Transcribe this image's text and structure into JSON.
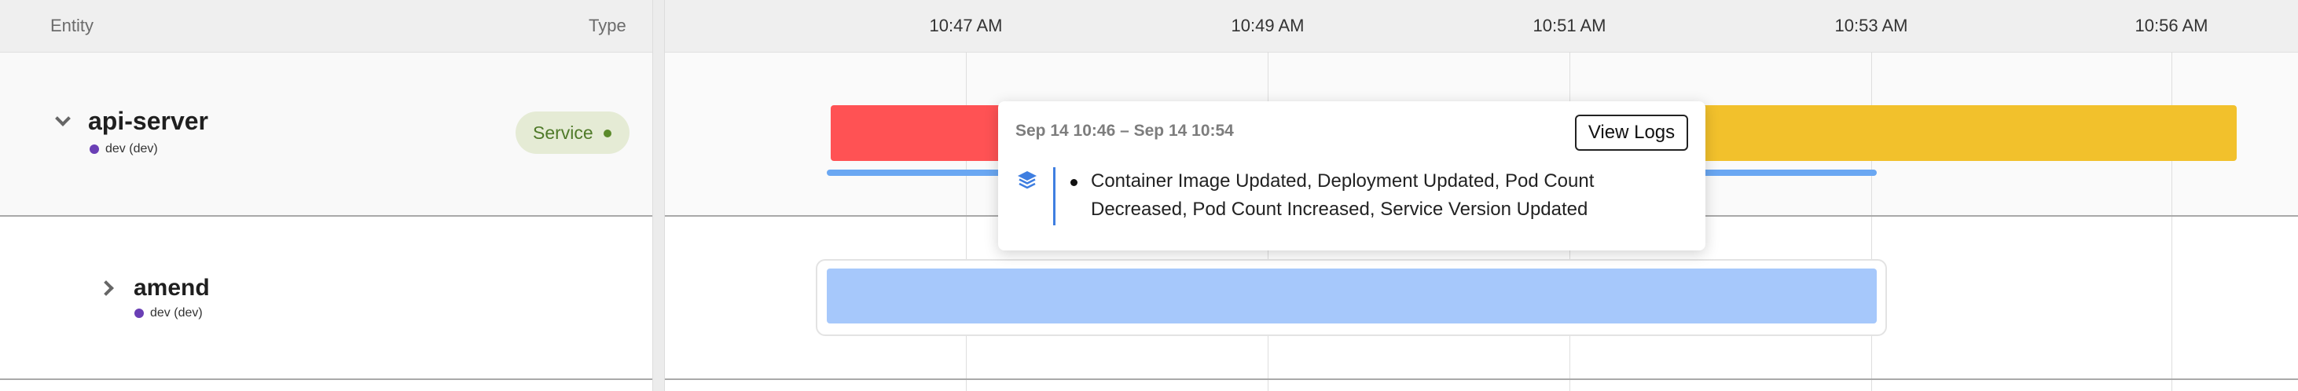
{
  "header": {
    "entity_col": "Entity",
    "type_col": "Type"
  },
  "time_axis": {
    "ticks": [
      "10:47 AM",
      "10:49 AM",
      "10:51 AM",
      "10:53 AM",
      "10:56 AM"
    ]
  },
  "rows": [
    {
      "name": "api-server",
      "env": "dev (dev)",
      "env_color": "#6a3fb5",
      "type_badge": "Service",
      "expanded": true
    },
    {
      "name": "amend",
      "env": "dev (dev)",
      "env_color": "#6a3fb5",
      "expanded": false
    }
  ],
  "bars": {
    "api_server": [
      {
        "kind": "event",
        "color": "#ff5254"
      },
      {
        "kind": "event",
        "color": "#f2c12c"
      },
      {
        "kind": "duration-line",
        "color": "#6aa7f2"
      }
    ],
    "amend": [
      {
        "kind": "duration",
        "color": "#a6c8fb"
      }
    ]
  },
  "tooltip": {
    "range": "Sep 14 10:46 – Sep 14 10:54",
    "button": "View Logs",
    "icon": "layers-icon",
    "events": "Container Image Updated, Deployment Updated, Pod Count Decreased, Pod Count Increased, Service Version Updated"
  }
}
